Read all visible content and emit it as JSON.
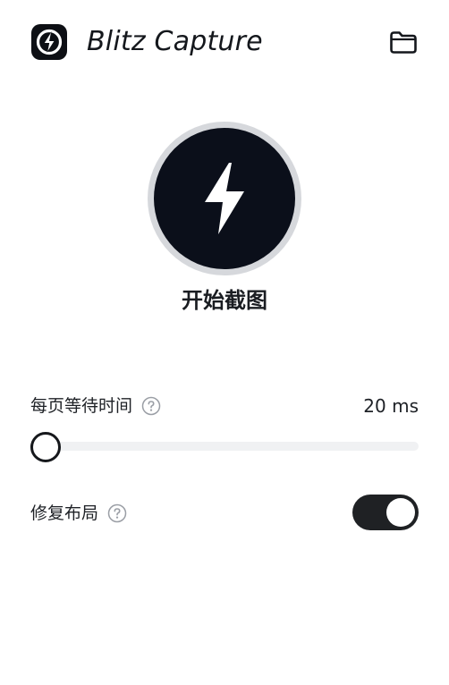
{
  "header": {
    "title": "Blitz Capture",
    "logo_icon": "bolt-logo-icon",
    "folder_icon": "folder-icon"
  },
  "capture": {
    "label": "开始截图",
    "icon": "lightning-bolt-icon"
  },
  "settings": {
    "wait": {
      "label": "每页等待时间",
      "value_text": "20 ms",
      "slider_fraction": 0.035,
      "help_icon": "question-circle-icon"
    },
    "fix_layout": {
      "label": "修复布局",
      "enabled": true,
      "help_icon": "question-circle-icon"
    }
  },
  "colors": {
    "accent": "#0b0f1a",
    "ring": "#d6d8dc",
    "track": "#f0f1f3"
  }
}
